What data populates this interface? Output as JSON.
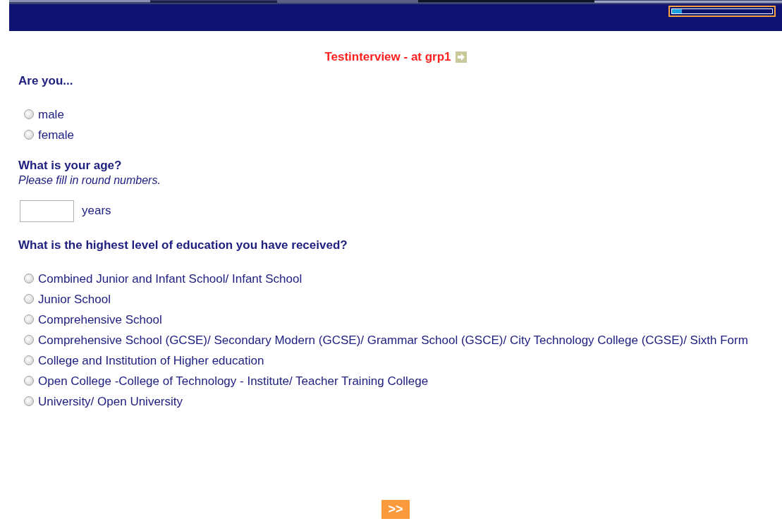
{
  "header": {
    "progress": {
      "level": 0.1
    }
  },
  "title": "Testinterview - at grp1",
  "questions": [
    {
      "kind": "radio",
      "text": "Are you...",
      "options": [
        {
          "label": "male",
          "selected": false
        },
        {
          "label": "female",
          "selected": false
        }
      ]
    },
    {
      "kind": "number",
      "text": "What is your age?",
      "hint": "Please fill in round numbers.",
      "unit": "years"
    },
    {
      "kind": "radio",
      "text": "What is the highest level of education you have received?",
      "options": [
        {
          "label": "Combined Junior and Infant School/ Infant School",
          "selected": false
        },
        {
          "label": "Junior School",
          "selected": false
        },
        {
          "label": "Comprehensive School",
          "selected": false
        },
        {
          "label": "Comprehensive School (GCSE)/ Secondary Modern (GCSE)/ Grammar School (GSCE)/ City Technology College (CGSE)/ Sixth Form",
          "selected": false
        },
        {
          "label": "College and Institution of Higher education",
          "selected": false
        },
        {
          "label": "Open College -College of Technology - Institute/ Teacher Training College",
          "selected": false
        },
        {
          "label": "University/ Open University",
          "selected": false
        }
      ]
    }
  ],
  "next_button": ">>"
}
